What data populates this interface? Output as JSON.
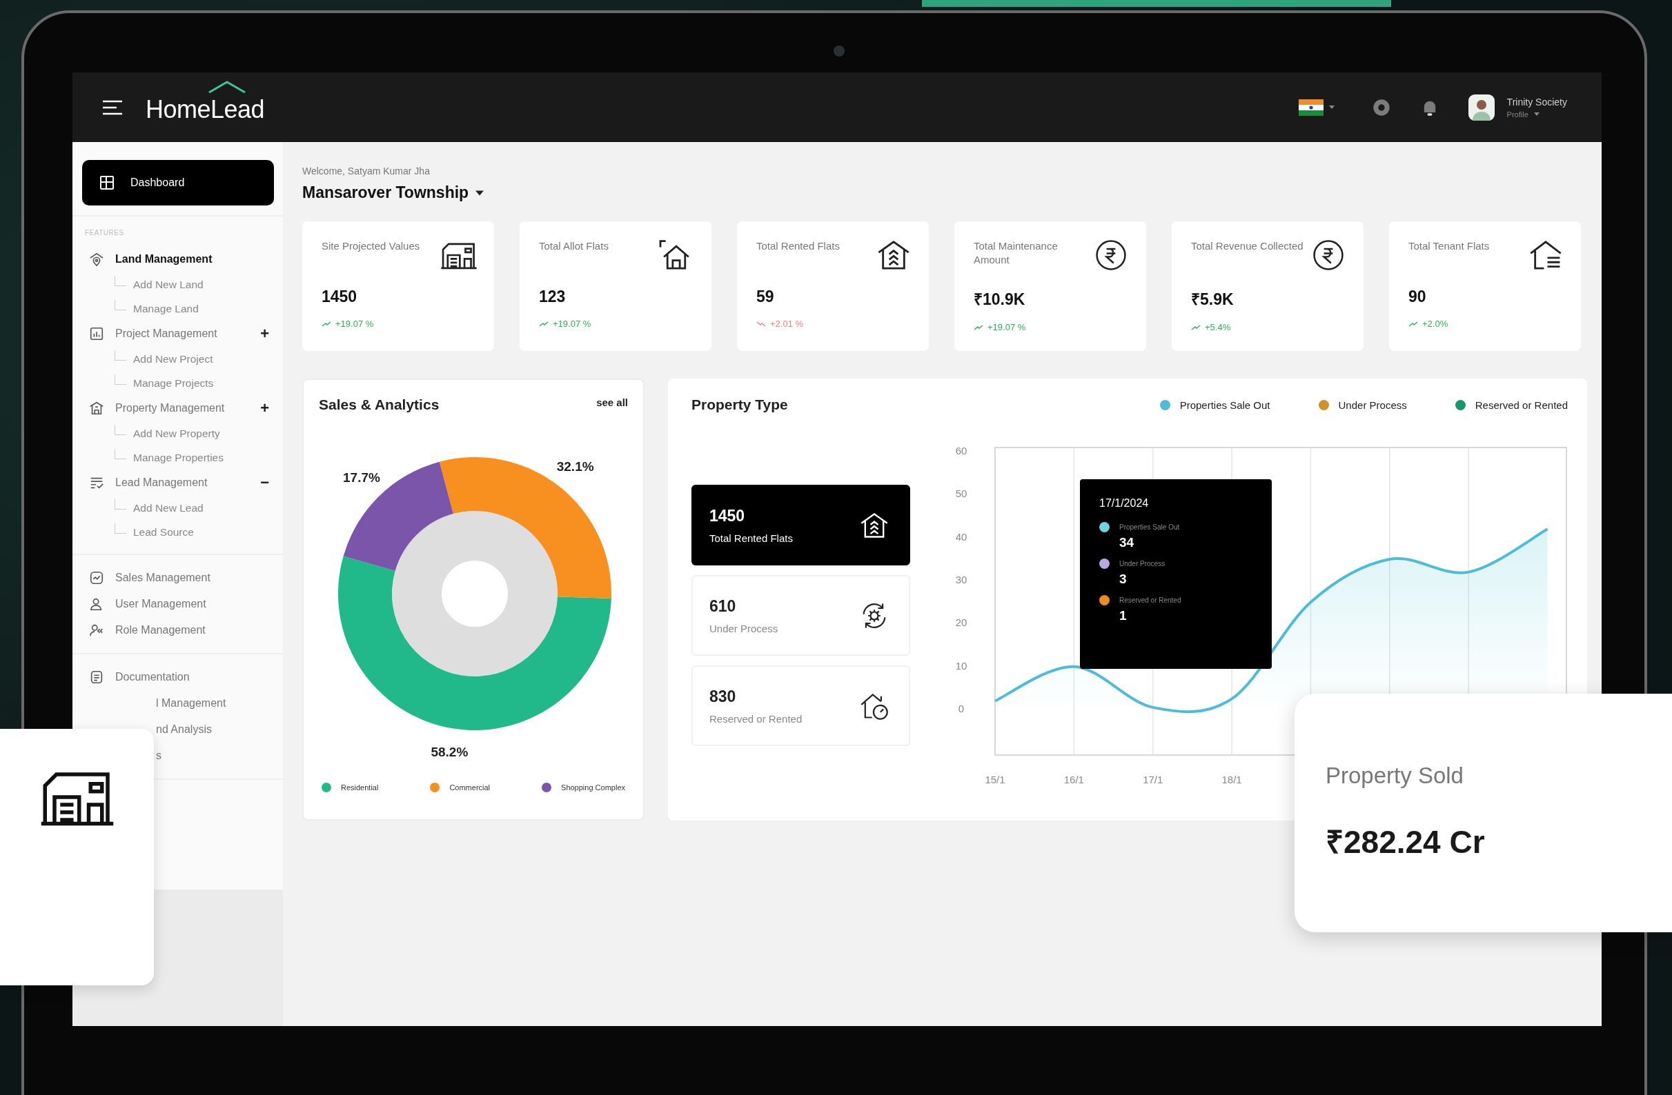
{
  "header": {
    "logo": "HomeLead",
    "user": {
      "name": "Trinity Society",
      "role": "Profile"
    }
  },
  "sidebar": {
    "dashboard": {
      "label": "Dashboard",
      "selected": true
    },
    "section_label": "FEATURES",
    "groups": [
      {
        "label": "Land Management",
        "selected": true,
        "children": [
          {
            "label": "Add New Land",
            "selected": false
          },
          {
            "label": "Manage Land",
            "selected": false
          }
        ]
      },
      {
        "label": "Project Management",
        "selected": false,
        "toggle": "+",
        "children": [
          {
            "label": "Add New Project",
            "selected": false
          },
          {
            "label": "Manage Projects",
            "selected": false
          }
        ]
      },
      {
        "label": "Property Management",
        "selected": false,
        "toggle": "+",
        "children": [
          {
            "label": "Add New Property",
            "selected": false
          },
          {
            "label": "Manage Properties",
            "selected": false
          }
        ]
      },
      {
        "label": "Lead Management",
        "selected": false,
        "toggle": "−",
        "children": [
          {
            "label": "Add New Lead",
            "selected": false
          },
          {
            "label": "Lead Source",
            "selected": false
          }
        ]
      }
    ],
    "links": [
      {
        "label": "Sales Management",
        "selected": false
      },
      {
        "label": "User Management",
        "selected": false
      },
      {
        "label": "Role Management",
        "selected": false
      }
    ],
    "more": [
      {
        "label": "Documentation",
        "kind": "full",
        "selected": false
      },
      {
        "label": "l Management",
        "kind": "partial",
        "selected": false
      },
      {
        "label": "nd Analysis",
        "kind": "partial",
        "selected": false
      },
      {
        "label": "s",
        "kind": "partial",
        "selected": false
      }
    ]
  },
  "welcome": "Welcome, Satyam Kumar Jha",
  "project": "Mansarover Township",
  "stats": [
    {
      "label": "Site Projected Values",
      "value": "1450",
      "change": "+19.07 %",
      "negative": false
    },
    {
      "label": "Total Allot Flats",
      "value": "123",
      "change": "+19.07 %",
      "negative": false
    },
    {
      "label": "Total Rented Flats",
      "value": "59",
      "change": "+2.01 %",
      "negative": true
    },
    {
      "label": "Total Maintenance Amount",
      "value": "₹10.9K",
      "change": "+19.07 %",
      "negative": false
    },
    {
      "label": "Total Revenue Collected",
      "value": "₹5.9K",
      "change": "+5.4%",
      "negative": false
    },
    {
      "label": "Total Tenant Flats",
      "value": "90",
      "change": "+2.0%",
      "negative": false
    }
  ],
  "sales": {
    "title": "Sales & Analytics",
    "link": "see all",
    "chart_data": {
      "type": "donut",
      "categories": [
        "Residential",
        "Commercial",
        "Shopping Complex"
      ],
      "values": [
        58.2,
        32.1,
        17.7
      ],
      "value_labels": [
        "58.2%",
        "32.1%",
        "17.7%"
      ]
    },
    "legend": [
      {
        "color": "#22b98a"
      },
      {
        "color": "#f7901e"
      },
      {
        "color": "#7b55a9"
      }
    ]
  },
  "property": {
    "title": "Property Type",
    "summaries": [
      {
        "value": "1450",
        "label": "Total Rented Flats",
        "selected": true
      },
      {
        "value": "610",
        "label": "Under Process",
        "selected": false
      },
      {
        "value": "830",
        "label": "Reserved or Rented",
        "selected": false
      }
    ],
    "chart_data": {
      "type": "area",
      "grid": true,
      "categories": [
        "15/1",
        "16/1",
        "17/1",
        "18/1",
        null,
        null,
        null,
        null
      ],
      "ylim": [
        -10.6,
        61
      ],
      "yticks": [
        0,
        10,
        20,
        30,
        40,
        50,
        60
      ],
      "series": [
        {
          "name": "Properties Sale Out",
          "color": "#4ebcd8",
          "values": [
            2,
            10,
            0.5,
            2.5,
            25,
            35,
            32,
            42
          ]
        },
        {
          "name": "Under Process",
          "color": "#d4912a",
          "values": [
            null,
            null,
            null,
            null,
            null,
            null,
            null,
            null
          ]
        },
        {
          "name": "Reserved or Rented",
          "color": "#15986c",
          "values": [
            null,
            null,
            null,
            null,
            null,
            null,
            null,
            null
          ]
        }
      ]
    },
    "tooltip": {
      "date": "17/1/2024",
      "entries": [
        {
          "label": "Properties Sale Out",
          "value": "34",
          "color": "#6fd3e0"
        },
        {
          "label": "Under Process",
          "value": "3",
          "color": "#b9a9e2"
        },
        {
          "label": "Reserved or Rented",
          "value": "1",
          "color": "#f08a24"
        }
      ]
    }
  },
  "property_sold": {
    "label": "Property Sold",
    "value": "₹282.24 Cr"
  }
}
